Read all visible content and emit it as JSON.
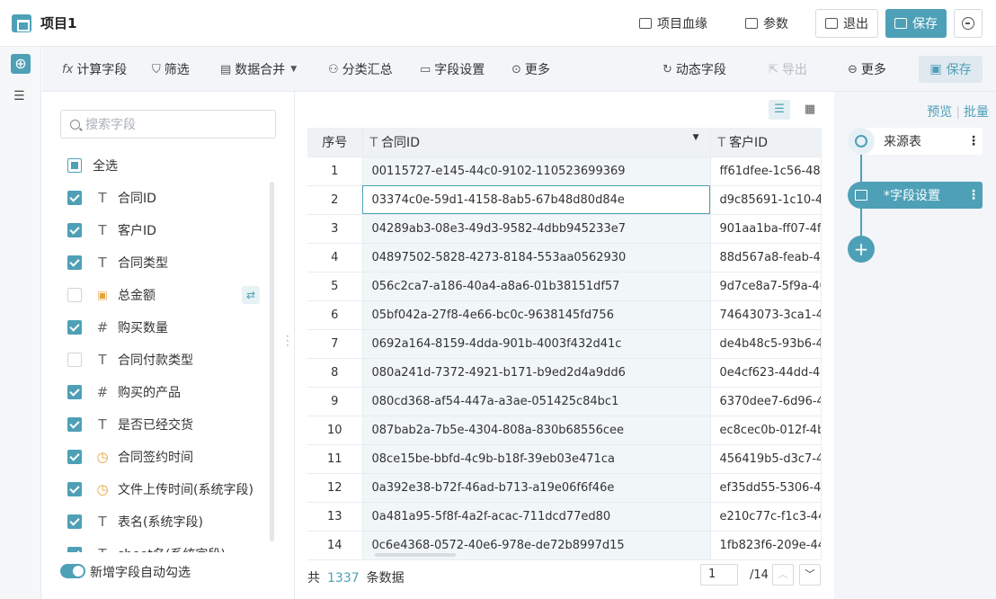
{
  "header": {
    "title": "项目1",
    "lineage": "项目血缘",
    "params": "参数",
    "exit": "退出",
    "save": "保存"
  },
  "toolbar": {
    "calc_field": "计算字段",
    "filter": "筛选",
    "merge": "数据合并",
    "group_summary": "分类汇总",
    "field_settings": "字段设置",
    "more_left": "更多",
    "dynamic_field": "动态字段",
    "export": "导出",
    "more_right": "更多",
    "save": "保存"
  },
  "field_panel": {
    "search_placeholder": "搜索字段",
    "select_all": "全选",
    "fields": [
      {
        "name": "合同ID",
        "type": "text",
        "checked": true
      },
      {
        "name": "客户ID",
        "type": "text",
        "checked": true
      },
      {
        "name": "合同类型",
        "type": "text",
        "checked": true
      },
      {
        "name": "总金额",
        "type": "formula",
        "checked": false
      },
      {
        "name": "购买数量",
        "type": "num",
        "checked": true
      },
      {
        "name": "合同付款类型",
        "type": "text",
        "checked": false
      },
      {
        "name": "购买的产品",
        "type": "num",
        "checked": true
      },
      {
        "name": "是否已经交货",
        "type": "text",
        "checked": true
      },
      {
        "name": "合同签约时间",
        "type": "date",
        "checked": true
      },
      {
        "name": "文件上传时间(系统字段)",
        "type": "date",
        "checked": true
      },
      {
        "name": "表名(系统字段)",
        "type": "text",
        "checked": true
      },
      {
        "name": "sheet名(系统字段)",
        "type": "text",
        "checked": true
      }
    ],
    "auto_check_label": "新增字段自动勾选"
  },
  "table": {
    "headers": {
      "seq": "序号",
      "col1": "合同ID",
      "col2": "客户ID"
    },
    "rows": [
      {
        "seq": "1",
        "c1": "00115727-e145-44c0-9102-110523699369",
        "c2": "ff61dfee-1c56-48b"
      },
      {
        "seq": "2",
        "c1": "03374c0e-59d1-4158-8ab5-67b48d80d84e",
        "c2": "d9c85691-1c10-4"
      },
      {
        "seq": "3",
        "c1": "04289ab3-08e3-49d3-9582-4dbb945233e7",
        "c2": "901aa1ba-ff07-4ff"
      },
      {
        "seq": "4",
        "c1": "04897502-5828-4273-8184-553aa0562930",
        "c2": "88d567a8-feab-4c"
      },
      {
        "seq": "5",
        "c1": "056c2ca7-a186-40a4-a8a6-01b38151df57",
        "c2": "9d7ce8a7-5f9a-40"
      },
      {
        "seq": "6",
        "c1": "05bf042a-27f8-4e66-bc0c-9638145fd756",
        "c2": "74643073-3ca1-4"
      },
      {
        "seq": "7",
        "c1": "0692a164-8159-4dda-901b-4003f432d41c",
        "c2": "de4b48c5-93b6-4"
      },
      {
        "seq": "8",
        "c1": "080a241d-7372-4921-b171-b9ed2d4a9dd6",
        "c2": "0e4cf623-44dd-47"
      },
      {
        "seq": "9",
        "c1": "080cd368-af54-447a-a3ae-051425c84bc1",
        "c2": "6370dee7-6d96-4"
      },
      {
        "seq": "10",
        "c1": "087bab2a-7b5e-4304-808a-830b68556cee",
        "c2": "ec8cec0b-012f-4b"
      },
      {
        "seq": "11",
        "c1": "08ce15be-bbfd-4c9b-b18f-39eb03e471ca",
        "c2": "456419b5-d3c7-4"
      },
      {
        "seq": "12",
        "c1": "0a392e38-b72f-46ad-b713-a19e06f6f46e",
        "c2": "ef35dd55-5306-43"
      },
      {
        "seq": "13",
        "c1": "0a481a95-5f8f-4a2f-acac-711dcd77ed80",
        "c2": "e210c77c-f1c3-44"
      },
      {
        "seq": "14",
        "c1": "0c6e4368-0572-40e6-978e-de72b8997d15",
        "c2": "1fb823f6-209e-44"
      }
    ],
    "selected_row": 1
  },
  "footer": {
    "prefix": "共",
    "total": "1337",
    "suffix": "条数据",
    "page": "1",
    "page_total": "/14"
  },
  "flow": {
    "preview": "预览",
    "batch": "批量",
    "source_node": "来源表",
    "current_node": "*字段设置"
  },
  "colors": {
    "accent": "#4ea0b7"
  }
}
